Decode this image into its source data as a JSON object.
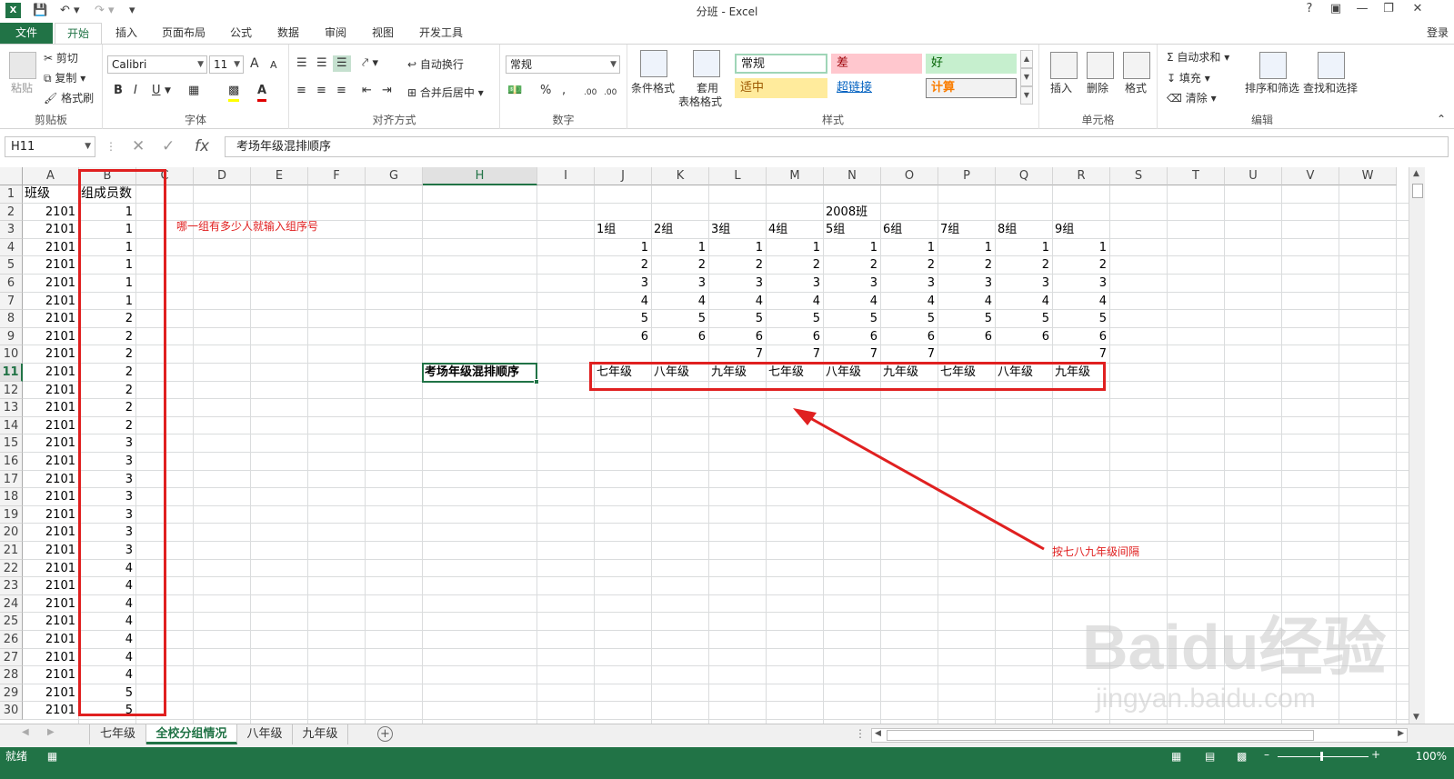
{
  "window": {
    "title": "分班 - Excel",
    "login": "登录",
    "help": "?",
    "logo": "X"
  },
  "tabs": [
    {
      "id": "file",
      "label": "文件"
    },
    {
      "id": "home",
      "label": "开始"
    },
    {
      "id": "insert",
      "label": "插入"
    },
    {
      "id": "layout",
      "label": "页面布局"
    },
    {
      "id": "formula",
      "label": "公式"
    },
    {
      "id": "data",
      "label": "数据"
    },
    {
      "id": "review",
      "label": "审阅"
    },
    {
      "id": "view",
      "label": "视图"
    },
    {
      "id": "dev",
      "label": "开发工具"
    }
  ],
  "ribbon": {
    "clipboard": {
      "label": "剪贴板",
      "paste": "粘贴",
      "cut": "剪切",
      "copy": "复制",
      "painter": "格式刷"
    },
    "font": {
      "label": "字体",
      "name": "Calibri",
      "size": "11",
      "bold": "B",
      "italic": "I",
      "underline": "U",
      "grow": "A",
      "shrink": "A",
      "color_letter": "A"
    },
    "align": {
      "label": "对齐方式",
      "wrap": "自动换行",
      "merge": "合并后居中"
    },
    "number": {
      "label": "数字",
      "format": "常规",
      "percent": "%",
      "comma": ",",
      "inc": ".00",
      "dec": ".00"
    },
    "styles": {
      "label": "样式",
      "cond": "条件格式",
      "table": "套用",
      "table2": "表格格式",
      "cells": [
        {
          "text": "常规",
          "bg": "#ffffff",
          "fg": "#000000",
          "border": "#9fd5b7"
        },
        {
          "text": "差",
          "bg": "#ffc7ce",
          "fg": "#9c0006",
          "border": "#ffc7ce"
        },
        {
          "text": "好",
          "bg": "#c6efce",
          "fg": "#006100",
          "border": "#c6efce"
        },
        {
          "text": "适中",
          "bg": "#ffeb9c",
          "fg": "#9c5700",
          "border": "#ffeb9c"
        },
        {
          "text": "超链接",
          "bg": "#ffffff",
          "fg": "#0563c1",
          "border": "#ffffff"
        },
        {
          "text": "计算",
          "bg": "#f2f2f2",
          "fg": "#fa7d00",
          "border": "#7f7f7f"
        }
      ]
    },
    "cellsgrp": {
      "label": "单元格",
      "insert": "插入",
      "delete": "删除",
      "format": "格式"
    },
    "edit": {
      "label": "编辑",
      "autosum": "自动求和",
      "fill": "填充",
      "clear": "清除",
      "sort": "排序和筛选",
      "find": "查找和选择"
    }
  },
  "formula_bar": {
    "name_box": "H11",
    "formula": "考场年级混排顺序",
    "fx": "fx",
    "cancel": "✕",
    "confirm": "✓"
  },
  "columns": [
    "A",
    "B",
    "C",
    "D",
    "E",
    "F",
    "G",
    "H",
    "I",
    "J",
    "K",
    "L",
    "M",
    "N",
    "O",
    "P",
    "Q",
    "R",
    "S",
    "T",
    "U",
    "V",
    "W"
  ],
  "rows": [
    "1",
    "2",
    "3",
    "4",
    "5",
    "6",
    "7",
    "8",
    "9",
    "10",
    "11",
    "12",
    "13",
    "14",
    "15",
    "16",
    "17",
    "18",
    "19",
    "20",
    "21",
    "22",
    "23",
    "24",
    "25",
    "26",
    "27",
    "28",
    "29",
    "30"
  ],
  "sheet": {
    "header_a": "班级",
    "header_b": "组成员数",
    "col_a": [
      "2101",
      "2101",
      "2101",
      "2101",
      "2101",
      "2101",
      "2101",
      "2101",
      "2101",
      "2101",
      "2101",
      "2101",
      "2101",
      "2101",
      "2101",
      "2101",
      "2101",
      "2101",
      "2101",
      "2101",
      "2101",
      "2101",
      "2101",
      "2101",
      "2101",
      "2101",
      "2101",
      "2101",
      "2101"
    ],
    "col_b": [
      "1",
      "1",
      "1",
      "1",
      "1",
      "1",
      "2",
      "2",
      "2",
      "2",
      "2",
      "2",
      "2",
      "3",
      "3",
      "3",
      "3",
      "3",
      "3",
      "3",
      "4",
      "4",
      "4",
      "4",
      "4",
      "4",
      "4",
      "5",
      "5"
    ],
    "class_title": "2008班",
    "groups": [
      "1组",
      "2组",
      "3组",
      "4组",
      "5组",
      "6组",
      "7组",
      "8组",
      "9组"
    ],
    "seq": [
      [
        "1",
        "1",
        "1",
        "1",
        "1",
        "1",
        "1",
        "1",
        "1"
      ],
      [
        "2",
        "2",
        "2",
        "2",
        "2",
        "2",
        "2",
        "2",
        "2"
      ],
      [
        "3",
        "3",
        "3",
        "3",
        "3",
        "3",
        "3",
        "3",
        "3"
      ],
      [
        "4",
        "4",
        "4",
        "4",
        "4",
        "4",
        "4",
        "4",
        "4"
      ],
      [
        "5",
        "5",
        "5",
        "5",
        "5",
        "5",
        "5",
        "5",
        "5"
      ],
      [
        "6",
        "6",
        "6",
        "6",
        "6",
        "6",
        "6",
        "6",
        "6"
      ],
      [
        "",
        "",
        "7",
        "7",
        "7",
        "7",
        "",
        "",
        "7"
      ]
    ],
    "h11": "考场年级混排顺序",
    "grades": [
      "七年级",
      "八年级",
      "九年级",
      "七年级",
      "八年级",
      "九年级",
      "七年级",
      "八年级",
      "九年级"
    ]
  },
  "annotations": {
    "note1": "哪一组有多少人就输入组序号",
    "note2": "按七八九年级间隔",
    "color": "#e02020"
  },
  "sheet_tabs": [
    "七年级",
    "全校分组情况",
    "八年级",
    "九年级"
  ],
  "active_sheet": "全校分组情况",
  "status": {
    "ready": "就绪",
    "zoom": "100%"
  },
  "watermark": {
    "text": "Baidu经验",
    "sub": "jingyan.baidu.com"
  }
}
